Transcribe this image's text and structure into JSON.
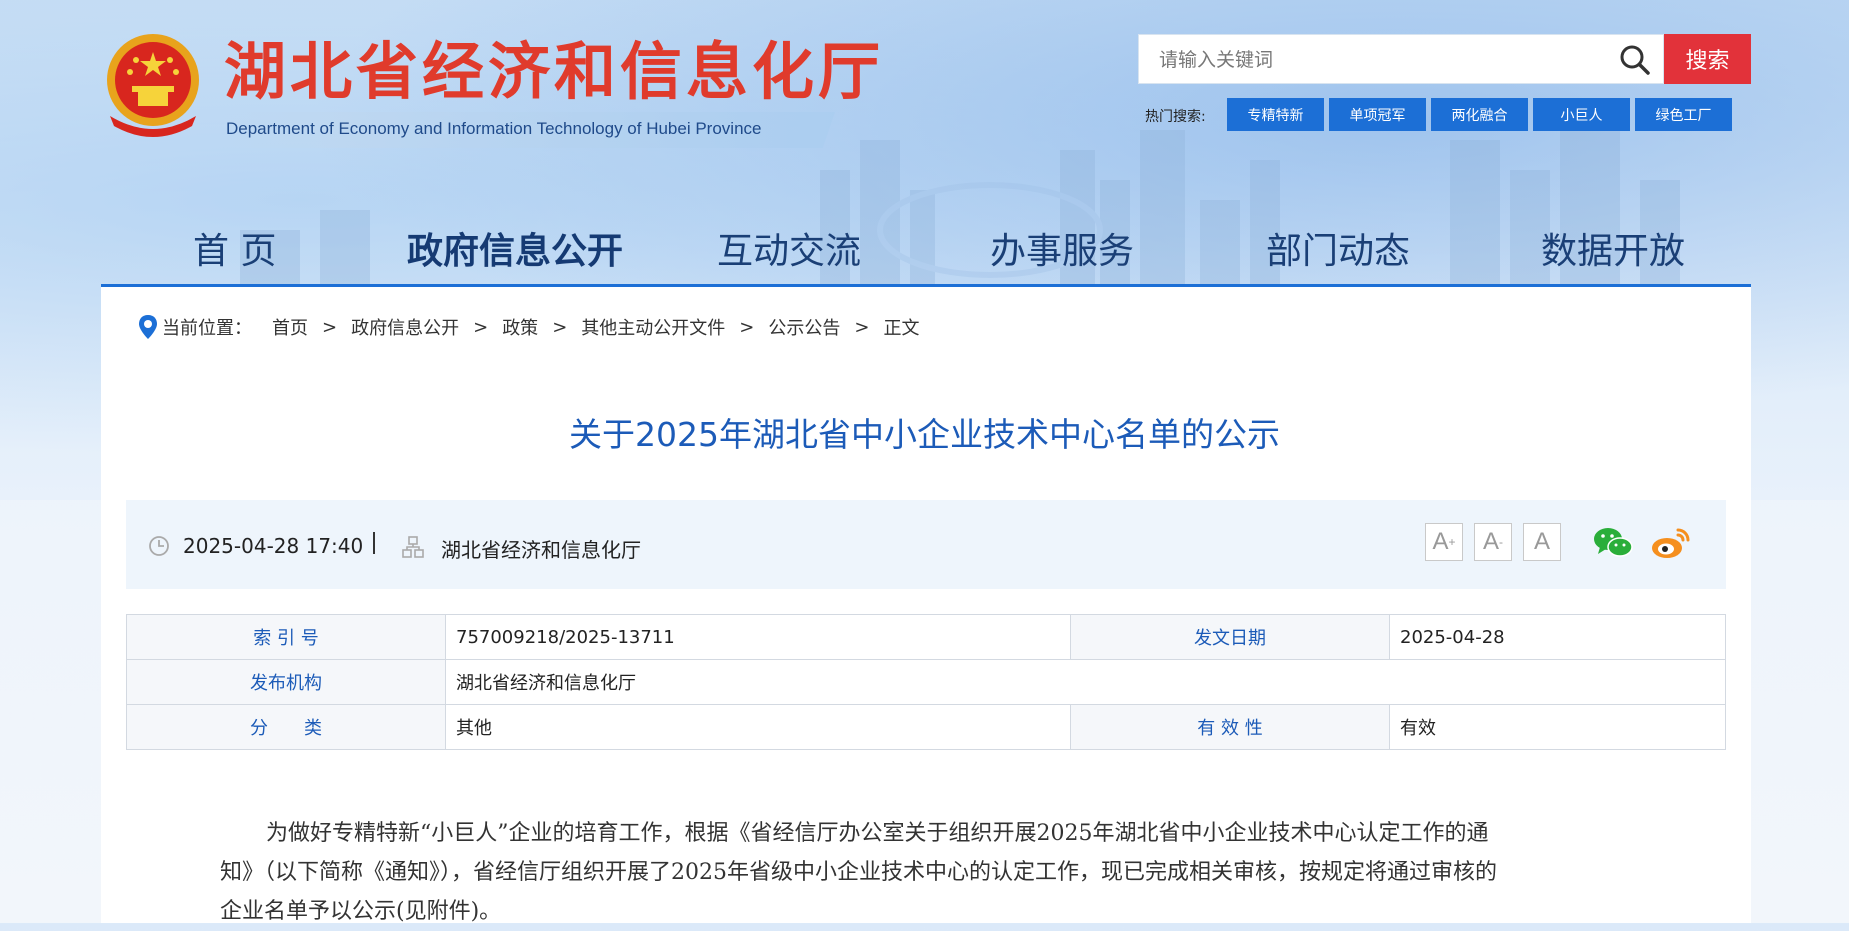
{
  "header": {
    "title": "湖北省经济和信息化厅",
    "subtitle": "Department of Economy and Information Technology of Hubei Province"
  },
  "search": {
    "placeholder": "请输入关键词",
    "button_label": "搜索",
    "hot_label": "热门搜索:",
    "hot_tags": [
      "专精特新",
      "单项冠军",
      "两化融合",
      "小巨人",
      "绿色工厂"
    ]
  },
  "nav": {
    "items": [
      "首 页",
      "政府信息公开",
      "互动交流",
      "办事服务",
      "部门动态",
      "数据开放"
    ],
    "active": "政府信息公开"
  },
  "breadcrumb": {
    "label": "当前位置：",
    "items": [
      "首页",
      "政府信息公开",
      "政策",
      "其他主动公开文件",
      "公示公告",
      "正文"
    ],
    "separator": ">"
  },
  "article": {
    "title": "关于2025年湖北省中小企业技术中心名单的公示",
    "date": "2025-04-28 17:40",
    "publisher": "湖北省经济和信息化厅",
    "font_buttons": [
      "A",
      "A",
      "A"
    ],
    "font_button_marks": [
      "+",
      "-",
      ""
    ]
  },
  "info_table": {
    "index_label": "索 引 号",
    "index_value": "757009218/2025-13711",
    "date_label": "发文日期",
    "date_value": "2025-04-28",
    "org_label": "发布机构",
    "org_value": "湖北省经济和信息化厅",
    "category_label": "分　　类",
    "category_value": "其他",
    "validity_label": "有 效 性",
    "validity_value": "有效"
  },
  "body": {
    "paragraph_1_line_1": "为做好专精特新“小巨人”企业的培育工作，根据《省经信厅办公室关于组织开展2025年湖北省中小企业技术中心认定工作的通",
    "paragraph_1_line_2": "知》（以下简称《通知》），省经信厅组织开展了2025年省级中小企业技术中心的认定工作，现已完成相关审核，按规定将通过审核的",
    "paragraph_1_line_3": "企业名单予以公示(见附件)。"
  },
  "colors": {
    "brand_red": "#e03b2c",
    "nav_blue": "#1c6fd6",
    "title_blue": "#1c5bb8",
    "search_red": "#e2323a"
  }
}
